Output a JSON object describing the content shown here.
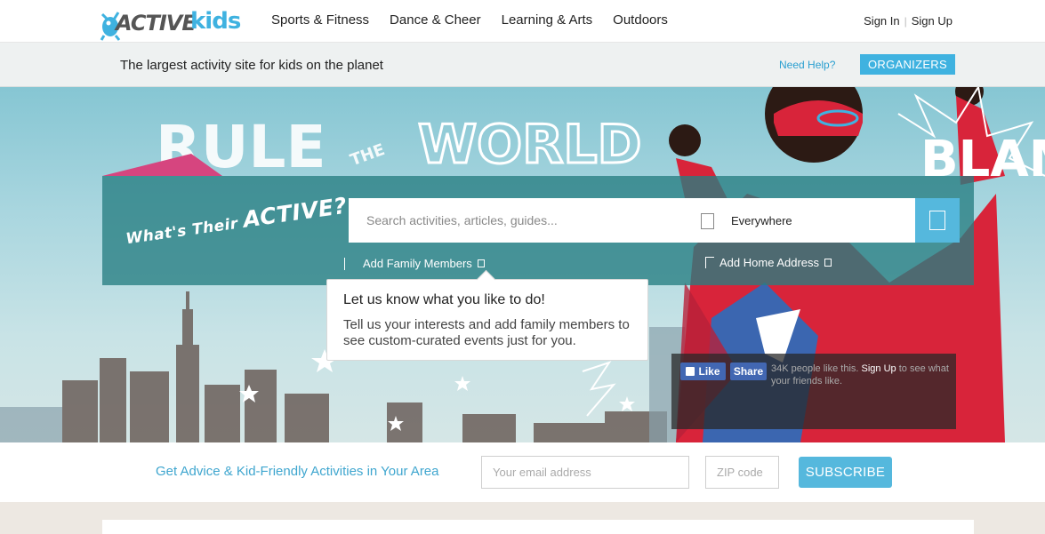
{
  "brand": {
    "logo_active": "ACTIVE",
    "logo_kids": "kids"
  },
  "nav": {
    "items": [
      "Sports & Fitness",
      "Dance & Cheer",
      "Learning & Arts",
      "Outdoors"
    ]
  },
  "auth": {
    "sign_in": "Sign In",
    "separator": "|",
    "sign_up": "Sign Up"
  },
  "tagbar": {
    "tagline": "The largest activity site for kids on the planet",
    "need_help": "Need Help?",
    "organizers": "ORGANIZERS"
  },
  "hero": {
    "headline_left": "RULE",
    "headline_mid": "THE",
    "headline_right": "WORLD",
    "blam": "BLAM"
  },
  "search": {
    "brand_prefix": "What's Their",
    "brand_word": "ACTIVE?",
    "placeholder": "Search activities, articles, guides...",
    "location": "Everywhere",
    "add_family": "Add Family Members",
    "add_home": "Add Home Address"
  },
  "tooltip": {
    "title": "Let us know what you like to do!",
    "body": "Tell us your interests and add family members to see custom-curated events just for you."
  },
  "facebook": {
    "like": "Like",
    "share": "Share",
    "count_text": "34K people like this.",
    "signup": "Sign Up",
    "rest": "to see what your friends like."
  },
  "newsletter": {
    "label": "Get Advice & Kid-Friendly Activities in Your Area",
    "email_placeholder": "Your email address",
    "zip_placeholder": "ZIP code",
    "subscribe": "SUBSCRIBE"
  },
  "colors": {
    "accent": "#3fb2e0",
    "panel": "#267e82",
    "hero_red": "#d8243a",
    "fb_blue": "#4267b2"
  }
}
